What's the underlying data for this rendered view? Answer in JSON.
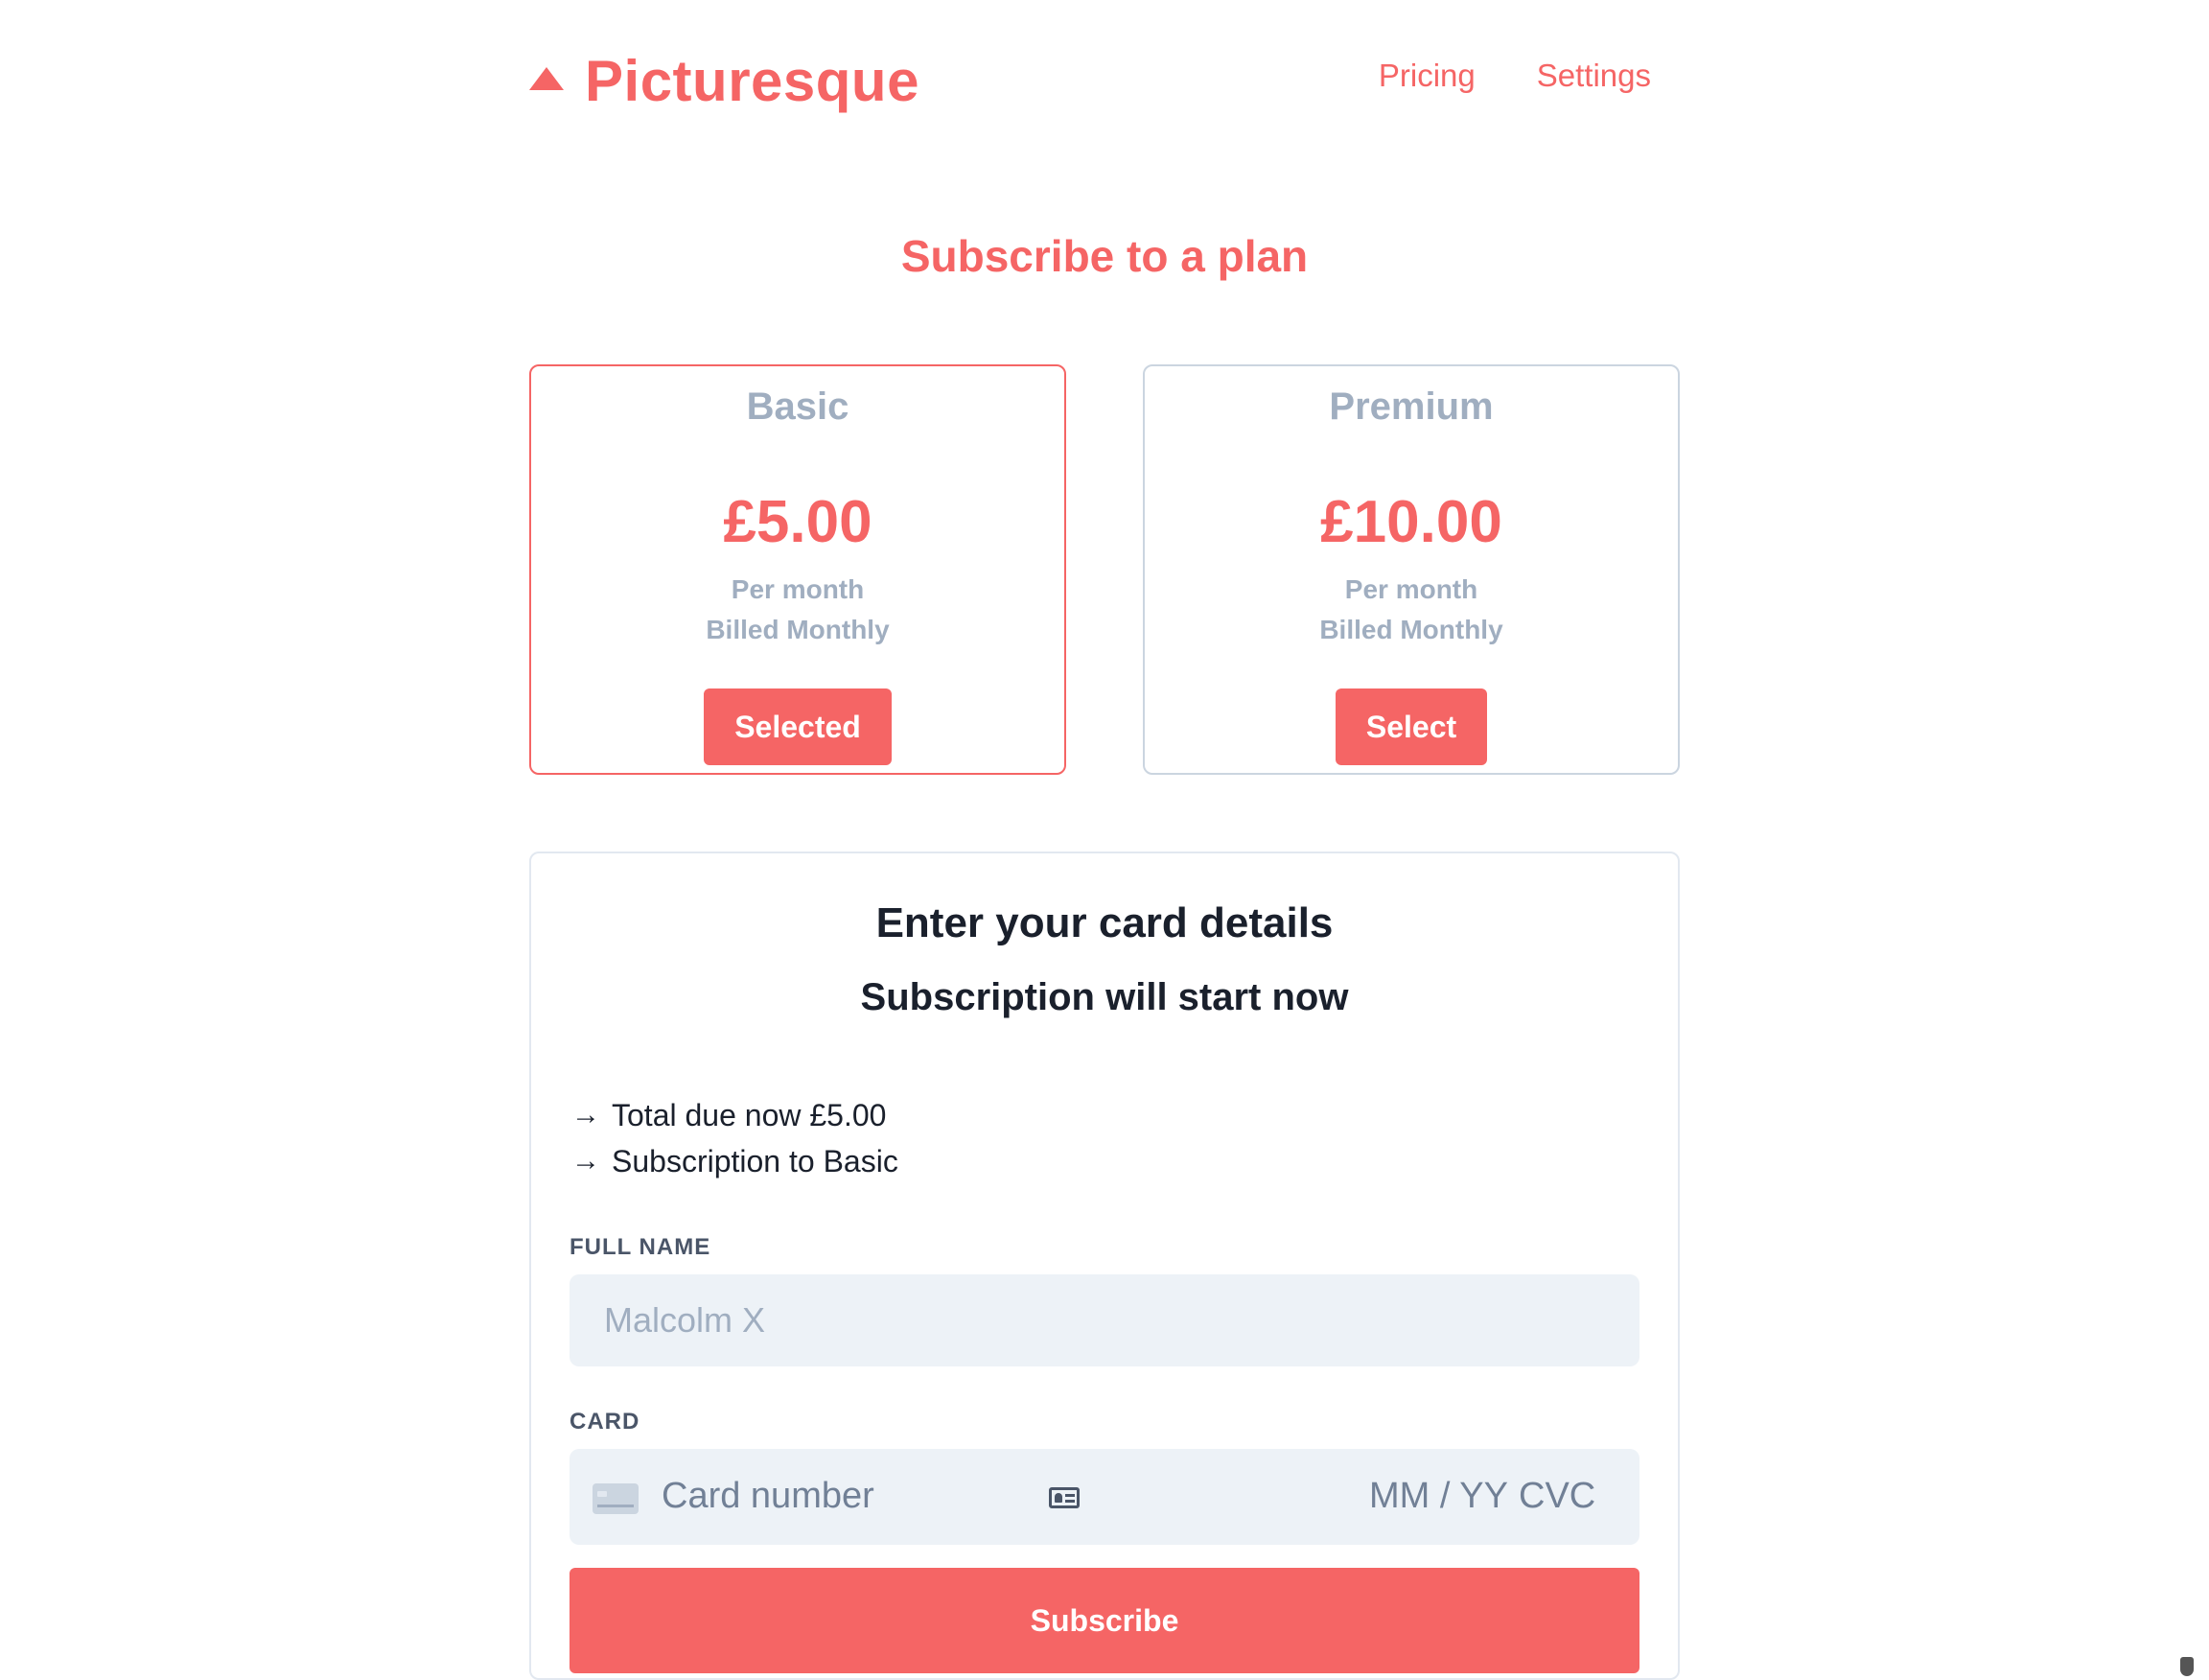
{
  "header": {
    "brand": "Picturesque",
    "nav": [
      {
        "label": "Pricing"
      },
      {
        "label": "Settings"
      }
    ]
  },
  "page": {
    "title": "Subscribe to a plan"
  },
  "plans": [
    {
      "name": "Basic",
      "price": "£5.00",
      "period": "Per month",
      "billing": "Billed Monthly",
      "button": "Selected",
      "selected": true
    },
    {
      "name": "Premium",
      "price": "£10.00",
      "period": "Per month",
      "billing": "Billed Monthly",
      "button": "Select",
      "selected": false
    }
  ],
  "checkout": {
    "title": "Enter your card details",
    "subtitle": "Subscription will start now",
    "summary": [
      {
        "arrow": "→",
        "text": "Total due now £5.00"
      },
      {
        "arrow": "→",
        "text": "Subscription to Basic"
      }
    ],
    "full_name_label": "FULL NAME",
    "full_name_placeholder": "Malcolm X",
    "card_label": "CARD",
    "card_number_placeholder": "Card number",
    "card_exp_placeholder": "MM / YY",
    "card_cvc_placeholder": "CVC",
    "submit_label": "Subscribe"
  },
  "colors": {
    "accent": "#f56565",
    "muted": "#a0aec0",
    "input_bg": "#edf2f7",
    "text": "#1a202c"
  }
}
